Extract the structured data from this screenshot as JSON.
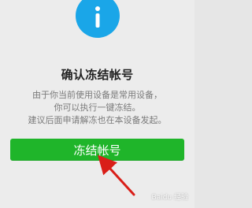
{
  "header": {
    "icon": "info-icon",
    "accent_color": "#1aa6e8"
  },
  "dialog": {
    "title": "确认冻结帐号",
    "description_lines": [
      "由于你当前使用设备是常用设备，",
      "你可以执行一键冻结。",
      "建议后面申请解冻也在本设备发起。"
    ]
  },
  "actions": {
    "freeze_button_label": "冻结帐号",
    "button_color": "#1fb52a"
  },
  "overlay": {
    "arrow_color": "#d91e18",
    "watermark": "Baidu 经验"
  }
}
